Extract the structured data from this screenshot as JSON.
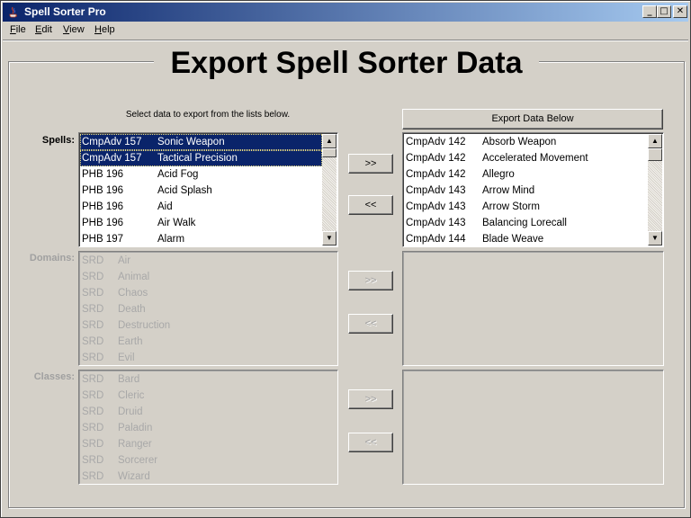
{
  "window": {
    "title": "Spell Sorter Pro",
    "controls": {
      "minimize": "_",
      "maximize": "□",
      "close": "✕"
    }
  },
  "menu": [
    {
      "mnemonic": "F",
      "rest": "ile"
    },
    {
      "mnemonic": "E",
      "rest": "dit"
    },
    {
      "mnemonic": "V",
      "rest": "iew"
    },
    {
      "mnemonic": "H",
      "rest": "elp"
    }
  ],
  "heading": "Export Spell Sorter Data",
  "instructions": "Select data to export from the lists below.",
  "export_button": "Export Data Below",
  "move_right_label": ">>",
  "move_left_label": "<<",
  "spells": {
    "label": "Spells:",
    "items": [
      {
        "source": "CmpAdv 157",
        "name": "Sonic Weapon",
        "selected": true
      },
      {
        "source": "CmpAdv 157",
        "name": "Tactical Precision",
        "selected": true
      },
      {
        "source": "PHB 196",
        "name": "Acid Fog",
        "selected": false
      },
      {
        "source": "PHB 196",
        "name": "Acid Splash",
        "selected": false
      },
      {
        "source": "PHB 196",
        "name": "Aid",
        "selected": false
      },
      {
        "source": "PHB 196",
        "name": "Air Walk",
        "selected": false
      },
      {
        "source": "PHB 197",
        "name": "Alarm",
        "selected": false
      }
    ]
  },
  "export_spells": {
    "items": [
      {
        "source": "CmpAdv 142",
        "name": "Absorb Weapon"
      },
      {
        "source": "CmpAdv 142",
        "name": "Accelerated Movement"
      },
      {
        "source": "CmpAdv 142",
        "name": "Allegro"
      },
      {
        "source": "CmpAdv 143",
        "name": "Arrow Mind"
      },
      {
        "source": "CmpAdv 143",
        "name": "Arrow Storm"
      },
      {
        "source": "CmpAdv 143",
        "name": "Balancing Lorecall"
      },
      {
        "source": "CmpAdv 144",
        "name": "Blade Weave"
      }
    ]
  },
  "domains": {
    "label": "Domains:",
    "items": [
      {
        "source": "SRD",
        "name": "Air"
      },
      {
        "source": "SRD",
        "name": "Animal"
      },
      {
        "source": "SRD",
        "name": "Chaos"
      },
      {
        "source": "SRD",
        "name": "Death"
      },
      {
        "source": "SRD",
        "name": "Destruction"
      },
      {
        "source": "SRD",
        "name": "Earth"
      },
      {
        "source": "SRD",
        "name": "Evil"
      }
    ]
  },
  "classes": {
    "label": "Classes:",
    "items": [
      {
        "source": "SRD",
        "name": "Bard"
      },
      {
        "source": "SRD",
        "name": "Cleric"
      },
      {
        "source": "SRD",
        "name": "Druid"
      },
      {
        "source": "SRD",
        "name": "Paladin"
      },
      {
        "source": "SRD",
        "name": "Ranger"
      },
      {
        "source": "SRD",
        "name": "Sorcerer"
      },
      {
        "source": "SRD",
        "name": "Wizard"
      }
    ]
  },
  "colors": {
    "selection": "#0a246a",
    "titlebar_start": "#0a246a",
    "titlebar_end": "#a6caf0",
    "face": "#d4d0c8"
  }
}
